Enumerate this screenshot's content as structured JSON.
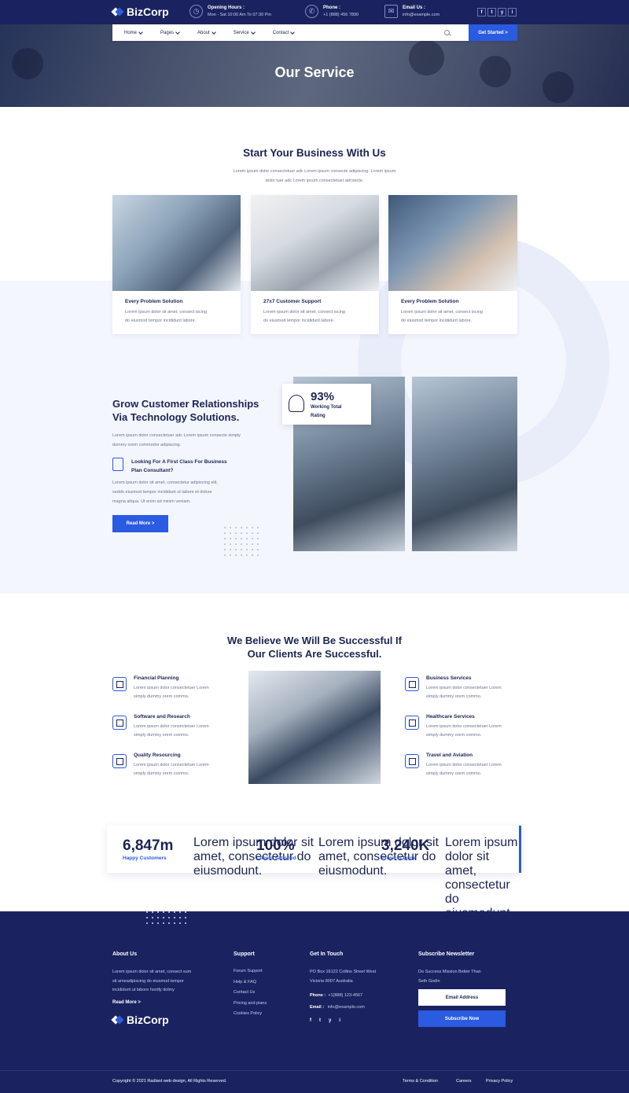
{
  "brand": {
    "name": "BizCorp"
  },
  "topbar": {
    "hours_title": "Opening Hours :",
    "hours_value": "Mon - Sat 10:00 Am To 07:30 Pm",
    "phone_title": "Phone :",
    "phone_value": "+1 (888) 456 7890",
    "email_title": "Email Us :",
    "email_value": "info@example.com",
    "social": [
      "f",
      "t",
      "y",
      "i"
    ]
  },
  "nav": {
    "items": [
      "Home",
      "Pages",
      "About",
      "Service",
      "Contact"
    ],
    "cta": "Get Started >"
  },
  "hero": {
    "title": "Our Service"
  },
  "start": {
    "title": "Start Your Business With Us",
    "text_1": "Lorem ipsum dolor consectetuer adc Lorem ipsum consecte adipiscing. Lorem ipsum",
    "text_2": "dolor tuer adc Lorem ipsum consectetuer adcsecte.",
    "cards": [
      {
        "title": "Every Problem Solution",
        "text_1": "Lorem ipsum dolor sit amet, consect iscing",
        "text_2": "do eiusmod tempor incididunt labore."
      },
      {
        "title": "27x7 Customer Support",
        "text_1": "Lorem ipsum dolor sit amet, consect iscing",
        "text_2": "do eiusmod tempor incididunt labore."
      },
      {
        "title": "Every Problem Solution",
        "text_1": "Lorem ipsum dolor sit amet, consect iscing",
        "text_2": "do eiusmod tempor incididunt labore."
      }
    ]
  },
  "grow": {
    "title_1": "Grow Customer Relationships",
    "title_2": "Via Technology Solutions.",
    "text_1": "Lorem ipsum dolor consectetuer adc Lorem ipsum consecte simply",
    "text_2": "dummy orem commodor adipiscing.",
    "feature_title_1": "Looking For A First Class For Business",
    "feature_title_2": "Plan Consultant?",
    "para_1": "Lorem ipsum dolor sit amet, consectetur adipiscing elit,",
    "para_2": "seddo eiusmod tempor incididunt ut labore et dolore",
    "para_3": "magna aliqua. Ut enim ad minim veniam.",
    "button": "Read More >",
    "rating_value": "93%",
    "rating_label_1": "Working Total",
    "rating_label_2": "Rating"
  },
  "believe": {
    "title_1": "We Believe We Will Be Successful If",
    "title_2": "Our Clients Are Successful.",
    "features": [
      {
        "title": "Financial Planning",
        "text_1": "Lorem ipsum dolor consectetuer Lorem",
        "text_2": "simply dummy orem commo."
      },
      {
        "title": "Software and Research",
        "text_1": "Lorem ipsum dolor consectetuer Lorem",
        "text_2": "simply dummy orem commo."
      },
      {
        "title": "Quality Resourcing",
        "text_1": "Lorem ipsum dolor consectetuer Lorem",
        "text_2": "simply dummy orem commo."
      },
      {
        "title": "Business Services",
        "text_1": "Lorem ipsum dolor consectetuer Lorem",
        "text_2": "simply dummy orem commo."
      },
      {
        "title": "Healthcare Services",
        "text_1": "Lorem ipsum dolor consectetuer Lorem",
        "text_2": "simply dummy orem commo."
      },
      {
        "title": "Travel and Aviation",
        "text_1": "Lorem ipsum dolor consectetuer Lorem",
        "text_2": "simply dummy orem commo."
      }
    ]
  },
  "stats": [
    {
      "num": "6,847m",
      "label": "Happy Customers",
      "d1": "Lorem ipsum dolor sit",
      "d2": "amet, consectetur do",
      "d3": "eiusmodunt."
    },
    {
      "num": "100%",
      "label": "Clients Satisfied",
      "d1": "Lorem ipsum dolor sit",
      "d2": "amet, consectetur do",
      "d3": "eiusmodunt."
    },
    {
      "num": "3,240K",
      "label": "Projects Done",
      "d1": "Lorem ipsum dolor sit",
      "d2": "amet, consectetur do",
      "d3": "eiusmodunt."
    }
  ],
  "footer": {
    "about_title": "About Us",
    "about_1": "Lorem ipsum dolor sit amet, consect sum",
    "about_2": "sit ameadipiscing do eiusmod tempor",
    "about_3": "incididunt ut labore hordly dolmy",
    "about_link": "Read More >",
    "support_title": "Support",
    "support_links": [
      "Forum Support",
      "Help & FAQ",
      "Contact Us",
      "Pricing and plans",
      "Cookies Policy"
    ],
    "touch_title": "Get In Touch",
    "address_1": "PO Box 16122 Collins Street West",
    "address_2": "Victoria 8007 Australia",
    "phone_label": "Phone :",
    "phone_value": "+1(888) 123-4567",
    "email_label": "Email :",
    "email_value": "info@example.com",
    "social": [
      "f",
      "t",
      "y",
      "i"
    ],
    "news_title": "Subscribe Newsletter",
    "news_1": "Do Success Mission Better Than",
    "news_2": "Seth Godin",
    "email_placeholder": "Email Address",
    "subscribe": "Subscribe Now",
    "copyright": "Copyright © 2021 Radiant web design, All Rights Reserved.",
    "bottom_links": [
      "Terms & Condition",
      "Careers",
      "Privacy Policy"
    ]
  }
}
